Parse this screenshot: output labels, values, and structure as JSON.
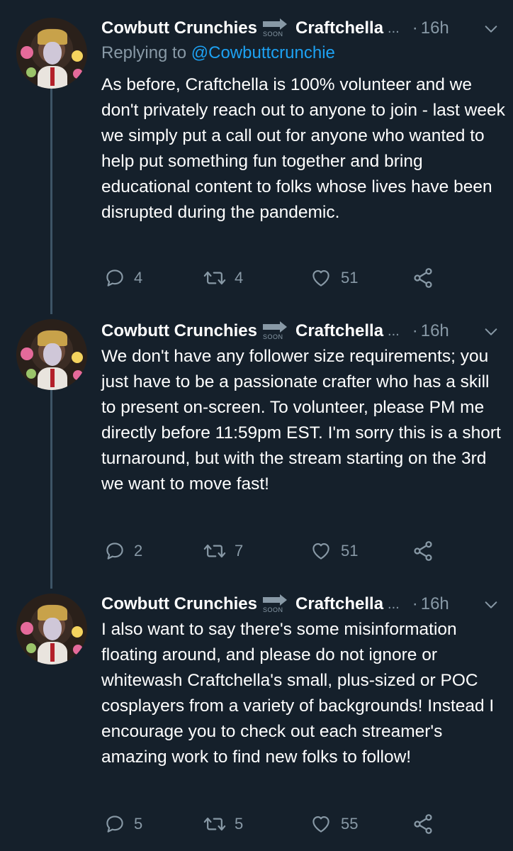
{
  "colors": {
    "background": "#15202b",
    "secondary_text": "#8899a6",
    "link": "#1da1f2",
    "thread_line": "#3d5466"
  },
  "icons": {
    "reply": "reply-icon",
    "retweet": "retweet-icon",
    "like": "heart-icon",
    "share": "share-icon",
    "more": "chevron-down-icon",
    "soon": "soon-arrow-icon"
  },
  "tweets": [
    {
      "author_name": "Cowbutt Crunchies",
      "soon_label": "SOON",
      "display_suffix": "Craftchella",
      "ellipsis": "...",
      "dot": "·",
      "time": "16h",
      "replying_prefix": "Replying to",
      "replying_handle": "@Cowbuttcrunchie",
      "text": "As before, Craftchella is 100% volunteer and we don't privately reach out to anyone to join - last week we simply put a call out for anyone who wanted to help put something fun together and bring educational content to folks whose lives have been disrupted during the pandemic.",
      "replies": "4",
      "retweets": "4",
      "likes": "51"
    },
    {
      "author_name": "Cowbutt Crunchies",
      "soon_label": "SOON",
      "display_suffix": "Craftchella",
      "ellipsis": "...",
      "dot": "·",
      "time": "16h",
      "text": "We don't have any follower size requirements; you just have to be a passionate crafter who has a skill to present on-screen. To volunteer, please PM me directly before 11:59pm EST. I'm sorry this is a short turnaround, but with the stream starting on the 3rd we want to move fast!",
      "replies": "2",
      "retweets": "7",
      "likes": "51"
    },
    {
      "author_name": "Cowbutt Crunchies",
      "soon_label": "SOON",
      "display_suffix": "Craftchella",
      "ellipsis": "...",
      "dot": "·",
      "time": "16h",
      "text": "I also want to say there's some misinformation floating around, and please do not ignore or whitewash Craftchella's small, plus-sized or POC cosplayers from a variety of backgrounds! Instead I encourage you to check out each streamer's amazing work to find new folks to follow!",
      "replies": "5",
      "retweets": "5",
      "likes": "55"
    }
  ]
}
